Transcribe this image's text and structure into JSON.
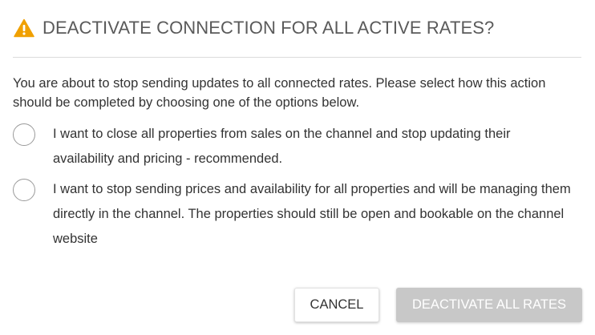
{
  "dialog": {
    "title": "DEACTIVATE CONNECTION FOR ALL ACTIVE RATES?",
    "warning_icon": "warning-triangle-icon",
    "warning_color": "#f0a000",
    "message": "You are about to stop sending updates to all connected rates. Please select how this action should be completed by choosing one of the options below.",
    "options": [
      {
        "label": "I want to close all properties from sales on the channel and stop updating their availability and pricing - recommended.",
        "selected": false
      },
      {
        "label": "I want to stop sending prices and availability for all properties and will be managing them directly in the channel. The properties should still be open and bookable on the channel website",
        "selected": false
      }
    ],
    "buttons": {
      "cancel_label": "CANCEL",
      "deactivate_label": "DEACTIVATE ALL RATES",
      "deactivate_disabled": true
    }
  }
}
